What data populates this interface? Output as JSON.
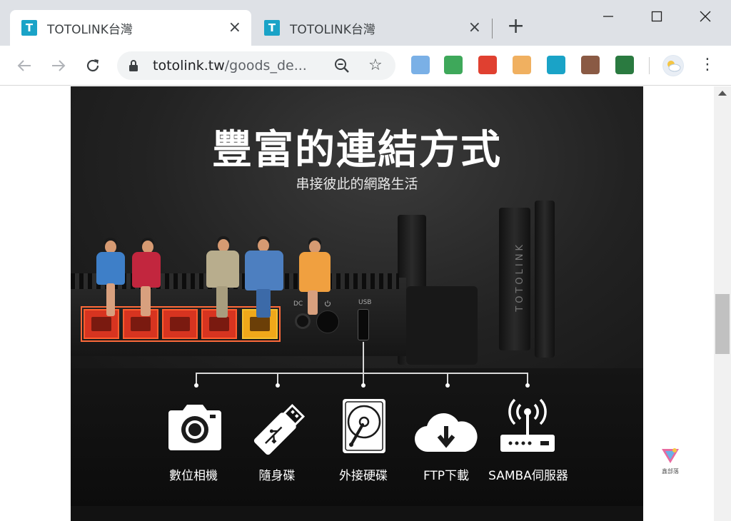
{
  "browser": {
    "tabs": [
      {
        "favicon": "T",
        "title": "TOTOLINK台灣",
        "close": "×",
        "active": true
      },
      {
        "favicon": "T",
        "title": "TOTOLINK台灣",
        "close": "×",
        "active": false
      }
    ],
    "new_tab": "+",
    "window_controls": {
      "minimize": "—",
      "maximize": "☐",
      "close": "✕"
    },
    "address": {
      "host": "totolink.tw",
      "path": "/goods_de..."
    },
    "icons": {
      "back": "arrow-left-icon",
      "forward": "arrow-right-icon",
      "reload": "reload-icon",
      "lock": "lock-icon",
      "zoom": "zoom-out-icon",
      "star": "star-icon"
    },
    "star_glyph": "☆",
    "menu_glyph": "⋮",
    "extensions": [
      {
        "name": "notes-extension-icon",
        "color": "#7ab0e6"
      },
      {
        "name": "mail-check-extension-icon",
        "color": "#3ea85a"
      },
      {
        "name": "shield-extension-icon",
        "color": "#e04030"
      },
      {
        "name": "face-extension-icon",
        "color": "#f0b060"
      },
      {
        "name": "share-extension-icon",
        "color": "#1aa3c7"
      },
      {
        "name": "avatar-extension-icon",
        "color": "#8a5a44"
      },
      {
        "name": "screen-capture-extension-icon",
        "color": "#2a7a40"
      }
    ]
  },
  "banner": {
    "headline": "豐富的連結方式",
    "subline": "串接彼此的網路生活",
    "port_labels": {
      "dc": "DC",
      "usb": "USB"
    },
    "brand_vertical": "TOTOLINK",
    "services": [
      {
        "label": "數位相機",
        "icon": "camera-icon"
      },
      {
        "label": "隨身碟",
        "icon": "usb-drive-icon"
      },
      {
        "label": "外接硬碟",
        "icon": "hard-disk-icon"
      },
      {
        "label": "FTP下載",
        "icon": "cloud-download-icon"
      },
      {
        "label": "SAMBA伺服器",
        "icon": "router-server-icon"
      }
    ]
  },
  "watermark": {
    "text": "鑫部落"
  },
  "colors": {
    "tab_accent": "#1aa3c7",
    "lan_port": "#d73420",
    "wan_port": "#f0a81a",
    "banner_bg": "#1b1b1b"
  }
}
